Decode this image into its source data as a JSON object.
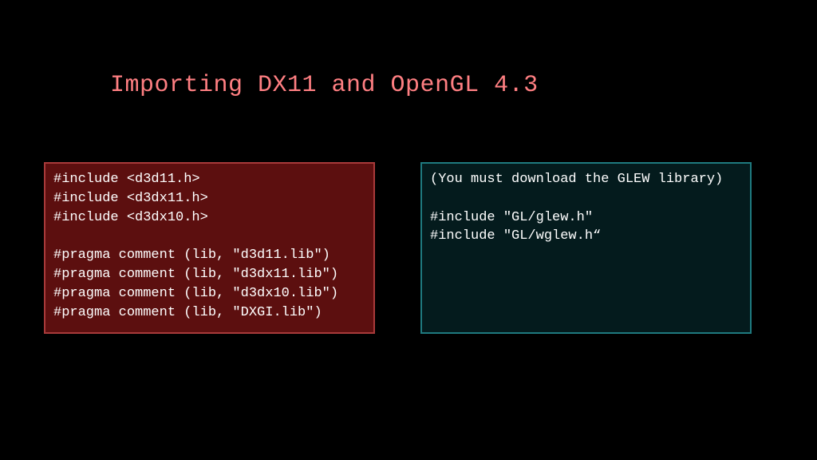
{
  "title": "Importing DX11 and OpenGL 4.3",
  "left_code": "#include <d3d11.h>\n#include <d3dx11.h>\n#include <d3dx10.h>\n\n#pragma comment (lib, \"d3d11.lib\")\n#pragma comment (lib, \"d3dx11.lib\")\n#pragma comment (lib, \"d3dx10.lib\")\n#pragma comment (lib, \"DXGI.lib\")",
  "right_code": "(You must download the GLEW library)\n\n#include \"GL/glew.h\"\n#include \"GL/wglew.h“"
}
